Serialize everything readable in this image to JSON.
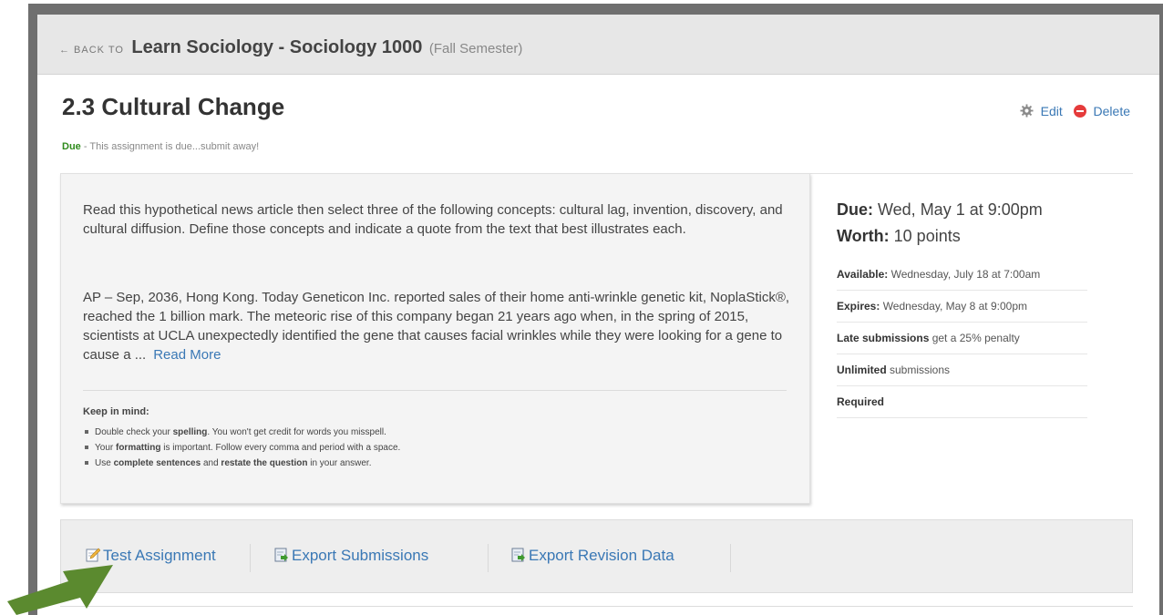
{
  "back": {
    "prefix": "← BACK TO",
    "course": "Learn Sociology - Sociology 1000",
    "semester": "(Fall Semester)"
  },
  "assignment": {
    "title": "2.3 Cultural Change",
    "due_badge": "Due",
    "due_message": " - This assignment is due...submit away!",
    "edit_label": "Edit",
    "delete_label": "Delete"
  },
  "description": {
    "intro": "Read this hypothetical news article then select three of the following concepts: cultural lag, invention, discovery, and cultural diffusion. Define those concepts and indicate a quote from the text that best illustrates each.",
    "article": "AP – Sep, 2036, Hong Kong. Today Geneticon Inc. reported sales of their home anti-wrinkle genetic kit, NoplaStick®, reached the 1 billion mark. The meteoric rise of this company began 21 years ago when, in the spring of 2015, scientists at UCLA unexpectedly identified the gene that causes facial wrinkles while they were looking for a gene to cause a ...",
    "read_more": "Read More",
    "keep_in_mind": "Keep in mind:",
    "tips": [
      {
        "a": "Double check your ",
        "b": "spelling",
        "c": ". You won't get credit for words you misspell.",
        "d": "",
        "e": "",
        "f": ""
      },
      {
        "a": "Your ",
        "b": "formatting",
        "c": " is important. Follow every comma and period with a space.",
        "d": "",
        "e": "",
        "f": ""
      },
      {
        "a": "Use ",
        "b": "complete sentences",
        "c": " and ",
        "d": "restate the question",
        "e": " in your answer.",
        "f": ""
      }
    ]
  },
  "details": {
    "due_label": "Due:",
    "due_value": " Wed, May 1 at 9:00pm",
    "worth_label": "Worth:",
    "worth_value": " 10 points",
    "available_label": "Available:",
    "available_value": " Wednesday, July 18 at 7:00am",
    "expires_label": "Expires:",
    "expires_value": " Wednesday, May 8 at 9:00pm",
    "late_label": "Late submissions",
    "late_value": " get a 25% penalty",
    "unlimited_label": "Unlimited",
    "unlimited_value": " submissions",
    "required_label": "Required"
  },
  "footer": {
    "test": "Test Assignment",
    "export_submissions": "Export Submissions",
    "export_revision": "Export Revision Data"
  },
  "colors": {
    "link": "#3a78b5",
    "due_green": "#2e8b1c",
    "arrow_green": "#5b8a2f",
    "delete_red": "#e53b3b"
  },
  "icons": [
    "gear-icon",
    "delete-icon",
    "pencil-icon",
    "export-icon",
    "green-arrow-annotation"
  ]
}
